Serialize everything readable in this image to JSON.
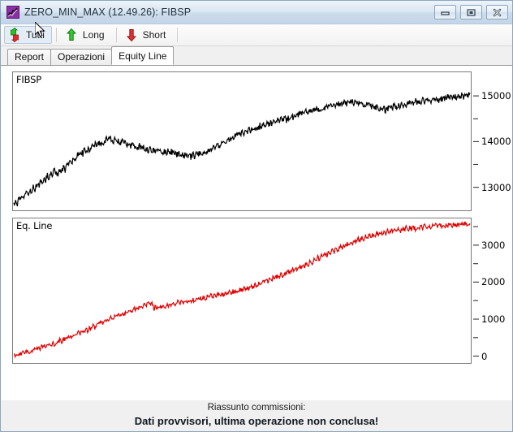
{
  "window": {
    "title": "ZERO_MIN_MAX (12.49.26): FIBSP",
    "icon": "chart-app-icon",
    "controls": {
      "minimize": "minimize-button",
      "maximize": "maximize-button",
      "close": "close-button"
    }
  },
  "toolbar": {
    "buttons": [
      {
        "label": "Tutti",
        "icon": "up-down-arrow-icon",
        "pressed": true
      },
      {
        "label": "Long",
        "icon": "green-up-arrow-icon",
        "pressed": false
      },
      {
        "label": "Short",
        "icon": "red-down-arrow-icon",
        "pressed": false
      }
    ]
  },
  "tabs": [
    {
      "label": "Report",
      "active": false
    },
    {
      "label": "Operazioni",
      "active": false
    },
    {
      "label": "Equity Line",
      "active": true
    }
  ],
  "scrollbar": {
    "left_arrow": "◄",
    "right_arrow": "►",
    "zoom_in": "+",
    "zoom_out": "−"
  },
  "footer": {
    "line1": "Riassunto commissioni:",
    "line2": "Dati provvisori, ultima operazione non conclusa!"
  },
  "colors": {
    "price_line": "#000000",
    "equity_line": "#e00000",
    "panel_border": "#7a7a7a",
    "titlebar_text": "#24333f"
  },
  "chart_data": [
    {
      "type": "line",
      "name": "price-chart",
      "title": "FIBSP",
      "xlabel": "",
      "ylabel": "",
      "grid": false,
      "legend": "none",
      "ylim": [
        12550,
        15500
      ],
      "yticks": [
        13000,
        14000,
        15000
      ],
      "ytick_labels": [
        "13000",
        "14000",
        "15000"
      ],
      "yminor": [
        13500,
        14500
      ],
      "series": [
        {
          "name": "FIBSP",
          "color": "#000000",
          "values": [
            12620,
            12700,
            12660,
            12760,
            12720,
            12830,
            12790,
            12900,
            12870,
            12960,
            12930,
            13020,
            12980,
            13080,
            13040,
            13140,
            13100,
            13210,
            13170,
            13280,
            13230,
            13330,
            13290,
            13400,
            13350,
            13300,
            13390,
            13340,
            13450,
            13400,
            13520,
            13470,
            13600,
            13560,
            13680,
            13640,
            13740,
            13690,
            13800,
            13750,
            13850,
            13800,
            13880,
            13830,
            13920,
            13870,
            13960,
            13900,
            13990,
            13940,
            14030,
            13980,
            14090,
            14040,
            14120,
            14060,
            14000,
            14060,
            13990,
            14050,
            13980,
            14040,
            13970,
            14020,
            13950,
            14000,
            13930,
            13980,
            13910,
            13950,
            13880,
            13930,
            13860,
            13910,
            13840,
            13890,
            13820,
            13870,
            13800,
            13850,
            13790,
            13840,
            13780,
            13830,
            13770,
            13820,
            13760,
            13810,
            13750,
            13800,
            13740,
            13780,
            13720,
            13770,
            13700,
            13750,
            13680,
            13740,
            13660,
            13720,
            13680,
            13740,
            13700,
            13760,
            13720,
            13780,
            13740,
            13800,
            13760,
            13830,
            13790,
            13860,
            13820,
            13900,
            13860,
            13940,
            13900,
            13990,
            13950,
            14040,
            14000,
            14090,
            14050,
            14140,
            14100,
            14180,
            14140,
            14220,
            14170,
            14240,
            14200,
            14270,
            14220,
            14290,
            14240,
            14320,
            14270,
            14340,
            14300,
            14370,
            14330,
            14400,
            14360,
            14420,
            14380,
            14450,
            14400,
            14470,
            14430,
            14490,
            14450,
            14510,
            14470,
            14530,
            14490,
            14560,
            14520,
            14580,
            14540,
            14600,
            14570,
            14630,
            14590,
            14660,
            14620,
            14680,
            14640,
            14700,
            14660,
            14720,
            14680,
            14740,
            14700,
            14760,
            14720,
            14780,
            14740,
            14800,
            14760,
            14820,
            14780,
            14840,
            14800,
            14860,
            14820,
            14870,
            14840,
            14880,
            14850,
            14890,
            14860,
            14900,
            14870,
            14880,
            14850,
            14860,
            14830,
            14850,
            14820,
            14840,
            14800,
            14820,
            14780,
            14800,
            14760,
            14780,
            14740,
            14760,
            14720,
            14740,
            14700,
            14730,
            14760,
            14790,
            14760,
            14800,
            14770,
            14810,
            14790,
            14830,
            14800,
            14850,
            14820,
            14870,
            14840,
            14880,
            14860,
            14900,
            14870,
            14910,
            14880,
            14920,
            14890,
            14930,
            14900,
            14940,
            14910,
            14950,
            14920,
            14960,
            14930,
            14970,
            14940,
            14980,
            14950,
            14990,
            14960,
            15000,
            14970,
            15010,
            14980,
            15020,
            14990,
            15030,
            15000,
            15040,
            15010,
            15050
          ]
        }
      ]
    },
    {
      "type": "line",
      "name": "equity-chart",
      "title": "Eq. Line",
      "xlabel": "",
      "ylabel": "",
      "grid": false,
      "legend": "none",
      "ylim": [
        -120,
        3700
      ],
      "yticks": [
        0,
        1000,
        2000,
        3000
      ],
      "ytick_labels": [
        "0",
        "1000",
        "2000",
        "3000"
      ],
      "yminor": [
        500,
        1500,
        2500,
        3500
      ],
      "series": [
        {
          "name": "Eq. Line",
          "color": "#e00000",
          "values": [
            30,
            60,
            40,
            80,
            60,
            110,
            90,
            140,
            120,
            170,
            150,
            210,
            180,
            240,
            210,
            270,
            240,
            300,
            270,
            330,
            300,
            370,
            340,
            410,
            380,
            450,
            420,
            490,
            460,
            530,
            500,
            570,
            540,
            610,
            580,
            650,
            620,
            700,
            660,
            740,
            700,
            790,
            750,
            840,
            800,
            890,
            850,
            940,
            900,
            990,
            950,
            1040,
            990,
            1080,
            1030,
            1120,
            1070,
            1160,
            1110,
            1200,
            1150,
            1240,
            1190,
            1280,
            1230,
            1320,
            1270,
            1360,
            1310,
            1400,
            1350,
            1440,
            1390,
            1480,
            1430,
            1520,
            1300,
            1360,
            1310,
            1380,
            1330,
            1400,
            1350,
            1420,
            1370,
            1440,
            1390,
            1460,
            1410,
            1480,
            1430,
            1500,
            1450,
            1520,
            1470,
            1540,
            1490,
            1560,
            1510,
            1580,
            1530,
            1600,
            1550,
            1620,
            1570,
            1640,
            1590,
            1660,
            1610,
            1680,
            1630,
            1700,
            1650,
            1720,
            1670,
            1740,
            1690,
            1760,
            1710,
            1780,
            1730,
            1800,
            1760,
            1830,
            1790,
            1860,
            1820,
            1890,
            1850,
            1920,
            1880,
            1960,
            1920,
            2000,
            1960,
            2040,
            2000,
            2080,
            2040,
            2120,
            2080,
            2160,
            2120,
            2200,
            2160,
            2240,
            2200,
            2280,
            2240,
            2320,
            2290,
            2370,
            2330,
            2410,
            2370,
            2460,
            2410,
            2500,
            2460,
            2550,
            2500,
            2590,
            2550,
            2640,
            2590,
            2690,
            2640,
            2740,
            2690,
            2790,
            2740,
            2840,
            2790,
            2890,
            2840,
            2940,
            2890,
            2990,
            2940,
            3030,
            2980,
            3070,
            3020,
            3110,
            3060,
            3150,
            3100,
            3190,
            3140,
            3230,
            3180,
            3260,
            3210,
            3290,
            3240,
            3310,
            3260,
            3340,
            3290,
            3360,
            3310,
            3390,
            3330,
            3410,
            3350,
            3430,
            3370,
            3450,
            3390,
            3470,
            3410,
            3480,
            3430,
            3490,
            3440,
            3500,
            3450,
            3510,
            3460,
            3520,
            3470,
            3530,
            3480,
            3540,
            3490,
            3550,
            3500,
            3560,
            3510,
            3560,
            3520,
            3570,
            3530,
            3570,
            3540,
            3580,
            3550,
            3580,
            3560,
            3590,
            3565,
            3590,
            3570,
            3595,
            3575,
            3600,
            3580,
            3600
          ]
        }
      ]
    }
  ]
}
